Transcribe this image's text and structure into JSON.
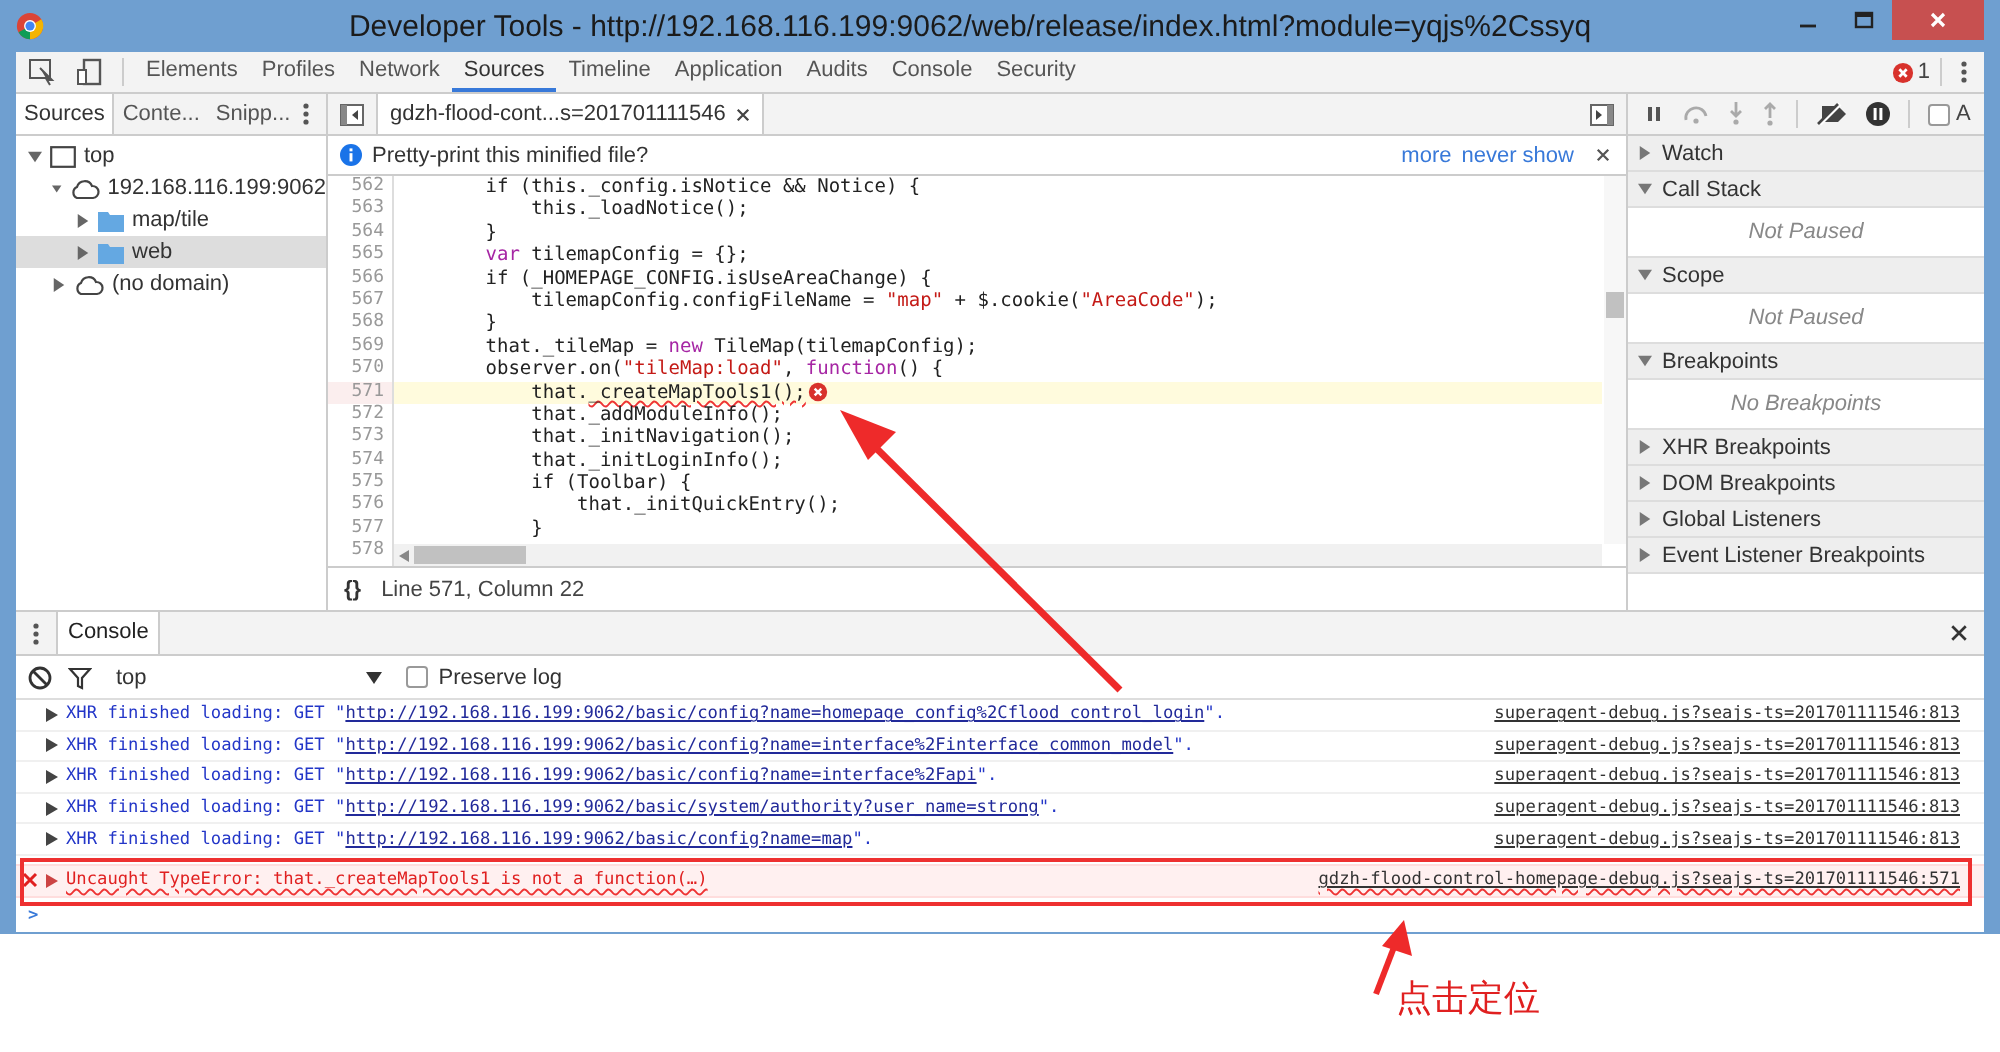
{
  "window": {
    "title": "Developer Tools - http://192.168.116.199:9062/web/release/index.html?module=yqjs%2Cssyq"
  },
  "toolbar": {
    "tabs": [
      {
        "label": "Elements",
        "selected": false
      },
      {
        "label": "Profiles",
        "selected": false
      },
      {
        "label": "Network",
        "selected": false
      },
      {
        "label": "Sources",
        "selected": true
      },
      {
        "label": "Timeline",
        "selected": false
      },
      {
        "label": "Application",
        "selected": false
      },
      {
        "label": "Audits",
        "selected": false
      },
      {
        "label": "Console",
        "selected": false
      },
      {
        "label": "Security",
        "selected": false
      }
    ],
    "error_count": "1"
  },
  "navigator": {
    "tabs": [
      {
        "label": "Sources",
        "selected": true
      },
      {
        "label": "Conte...",
        "selected": false
      },
      {
        "label": "Snipp...",
        "selected": false
      }
    ],
    "tree": [
      {
        "label": "top",
        "kind": "frame",
        "expanded": true,
        "selected": false,
        "children": [
          {
            "label": "192.168.116.199:9062",
            "kind": "domain",
            "expanded": true,
            "selected": false,
            "children": [
              {
                "label": "map/tile",
                "kind": "folder",
                "expanded": false,
                "selected": false
              },
              {
                "label": "web",
                "kind": "folder",
                "expanded": false,
                "selected": true
              }
            ]
          },
          {
            "label": "(no domain)",
            "kind": "domain",
            "expanded": false,
            "selected": false
          }
        ]
      }
    ]
  },
  "editor": {
    "file_tab": {
      "label": "gdzh-flood-cont...s=201701111546"
    },
    "infobar": {
      "message": "Pretty-print this minified file?",
      "links": [
        "more",
        "never show"
      ]
    },
    "lines": [
      {
        "number": "562",
        "highlighted": false,
        "segments": [
          {
            "kind": "plain",
            "text": "        if (this._config.isNotice && Notice) {"
          }
        ]
      },
      {
        "number": "563",
        "highlighted": false,
        "segments": [
          {
            "kind": "plain",
            "text": "            this._loadNotice();"
          }
        ]
      },
      {
        "number": "564",
        "highlighted": false,
        "segments": [
          {
            "kind": "plain",
            "text": "        }"
          }
        ]
      },
      {
        "number": "565",
        "highlighted": false,
        "segments": [
          {
            "kind": "keyword",
            "text": "        var"
          },
          {
            "kind": "plain",
            "text": " tilemapConfig = {};"
          }
        ]
      },
      {
        "number": "566",
        "highlighted": false,
        "segments": [
          {
            "kind": "plain",
            "text": "        if (_HOMEPAGE_CONFIG.isUseAreaChange) {"
          }
        ]
      },
      {
        "number": "567",
        "highlighted": false,
        "segments": [
          {
            "kind": "plain",
            "text": "            tilemapConfig.configFileName = "
          },
          {
            "kind": "string",
            "text": "\"map\""
          },
          {
            "kind": "plain",
            "text": " + $.cookie("
          },
          {
            "kind": "string",
            "text": "\"AreaCode\""
          },
          {
            "kind": "plain",
            "text": ");"
          }
        ]
      },
      {
        "number": "568",
        "highlighted": false,
        "segments": [
          {
            "kind": "plain",
            "text": "        }"
          }
        ]
      },
      {
        "number": "569",
        "highlighted": false,
        "segments": [
          {
            "kind": "plain",
            "text": "        that._tileMap = "
          },
          {
            "kind": "keyword",
            "text": "new"
          },
          {
            "kind": "plain",
            "text": " TileMap(tilemapConfig);"
          }
        ]
      },
      {
        "number": "570",
        "highlighted": false,
        "segments": [
          {
            "kind": "plain",
            "text": "        observer.on("
          },
          {
            "kind": "string",
            "text": "\"tileMap:load\""
          },
          {
            "kind": "plain",
            "text": ", "
          },
          {
            "kind": "keyword",
            "text": "function"
          },
          {
            "kind": "plain",
            "text": "() {"
          }
        ]
      },
      {
        "number": "571",
        "highlighted": true,
        "error": true,
        "segments": [
          {
            "kind": "plain",
            "text": "            that."
          },
          {
            "kind": "error",
            "text": "_createMapTools1();"
          }
        ]
      },
      {
        "number": "572",
        "highlighted": false,
        "segments": [
          {
            "kind": "plain",
            "text": "            that._addModuleInfo();"
          }
        ]
      },
      {
        "number": "573",
        "highlighted": false,
        "segments": [
          {
            "kind": "plain",
            "text": "            that._initNavigation();"
          }
        ]
      },
      {
        "number": "574",
        "highlighted": false,
        "segments": [
          {
            "kind": "plain",
            "text": "            that._initLoginInfo();"
          }
        ]
      },
      {
        "number": "575",
        "highlighted": false,
        "segments": [
          {
            "kind": "plain",
            "text": "            if (Toolbar) {"
          }
        ]
      },
      {
        "number": "576",
        "highlighted": false,
        "segments": [
          {
            "kind": "plain",
            "text": "                that._initQuickEntry();"
          }
        ]
      },
      {
        "number": "577",
        "highlighted": false,
        "segments": [
          {
            "kind": "plain",
            "text": "            }"
          }
        ]
      },
      {
        "number": "578",
        "highlighted": false
      }
    ],
    "status": {
      "brace": "{}",
      "position": "Line 571, Column 22"
    }
  },
  "debugger": {
    "async_label": "A",
    "async_checked": false,
    "sections": [
      {
        "title": "Watch",
        "expanded": false
      },
      {
        "title": "Call Stack",
        "expanded": true,
        "body": "Not Paused"
      },
      {
        "title": "Scope",
        "expanded": true,
        "body": "Not Paused"
      },
      {
        "title": "Breakpoints",
        "expanded": true,
        "body": "No Breakpoints"
      },
      {
        "title": "XHR Breakpoints",
        "expanded": false
      },
      {
        "title": "DOM Breakpoints",
        "expanded": false
      },
      {
        "title": "Global Listeners",
        "expanded": false
      },
      {
        "title": "Event Listener Breakpoints",
        "expanded": false
      }
    ]
  },
  "console": {
    "tab": {
      "label": "Console",
      "selected": true
    },
    "context": "top",
    "preserve_log": {
      "label": "Preserve log",
      "checked": false
    },
    "messages": [
      {
        "kind": "xhr",
        "prefix": "XHR finished loading: GET \"",
        "url": "http://192.168.116.199:9062/basic/config?name=homepage_config%2Cflood_control_login",
        "suffix": "\".",
        "source": "superagent-debug.js?seajs-ts=201701111546:813"
      },
      {
        "kind": "xhr",
        "prefix": "XHR finished loading: GET \"",
        "url": "http://192.168.116.199:9062/basic/config?name=interface%2Finterface_common_model",
        "suffix": "\".",
        "source": "superagent-debug.js?seajs-ts=201701111546:813"
      },
      {
        "kind": "xhr",
        "prefix": "XHR finished loading: GET \"",
        "url": "http://192.168.116.199:9062/basic/config?name=interface%2Fapi",
        "suffix": "\".",
        "source": "superagent-debug.js?seajs-ts=201701111546:813"
      },
      {
        "kind": "xhr",
        "prefix": "XHR finished loading: GET \"",
        "url": "http://192.168.116.199:9062/basic/system/authority?user_name=strong",
        "suffix": "\".",
        "source": "superagent-debug.js?seajs-ts=201701111546:813"
      },
      {
        "kind": "xhr",
        "prefix": "XHR finished loading: GET \"",
        "url": "http://192.168.116.199:9062/basic/config?name=map",
        "suffix": "\".",
        "source": "superagent-debug.js?seajs-ts=201701111546:813"
      },
      {
        "kind": "error",
        "prefix": "Uncaught TypeError: that._createMapTools1 is not a function(…)",
        "source": "gdzh-flood-control-homepage-debug.js?seajs-ts=201701111546:571"
      }
    ],
    "prompt": ">"
  },
  "annotation": {
    "label": "点击定位"
  }
}
